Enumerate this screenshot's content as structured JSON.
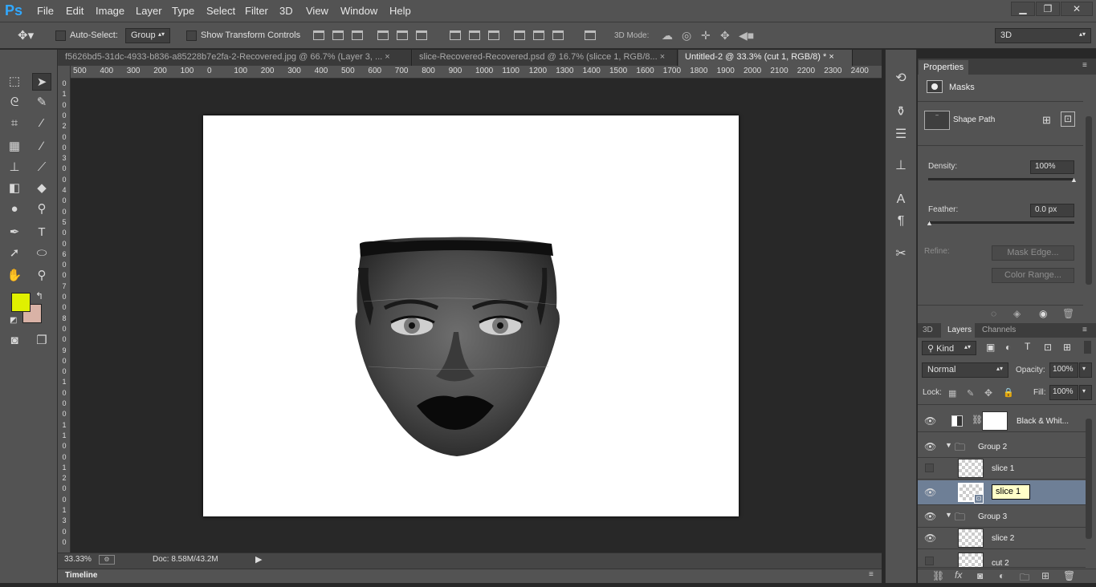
{
  "app": {
    "logo": "Ps"
  },
  "menu": [
    "File",
    "Edit",
    "Image",
    "Layer",
    "Type",
    "Select",
    "Filter",
    "3D",
    "View",
    "Window",
    "Help"
  ],
  "window_controls": {
    "minimize": "▁",
    "restore": "❐",
    "close": "✕"
  },
  "options": {
    "auto_select_label": "Auto-Select:",
    "auto_select_value": "Group",
    "show_transform_label": "Show Transform Controls",
    "mode3d_label": "3D Mode:",
    "workspace_value": "3D"
  },
  "tabs": [
    {
      "label": "f5626bd5-31dc-4933-b836-a85228b7e2fa-2-Recovered.jpg @ 66.7% (Layer 3, ...",
      "close": "×"
    },
    {
      "label": "slice-Recovered-Recovered.psd @ 16.7% (slicce 1, RGB/8...",
      "close": "×"
    },
    {
      "label": "Untitled-2 @ 33.3% (cut 1, RGB/8) *",
      "close": "×"
    }
  ],
  "ruler_h": [
    "500",
    "400",
    "300",
    "200",
    "100",
    "0",
    "100",
    "200",
    "300",
    "400",
    "500",
    "600",
    "700",
    "800",
    "900",
    "1000",
    "1100",
    "1200",
    "1300",
    "1400",
    "1500",
    "1600",
    "1700",
    "1800",
    "1900",
    "2000",
    "2100",
    "2200",
    "2300",
    "2400"
  ],
  "ruler_v": [
    "0",
    "1",
    "0",
    "0",
    "2",
    "0",
    "0",
    "3",
    "0",
    "0",
    "4",
    "0",
    "0",
    "5",
    "0",
    "0",
    "6",
    "0",
    "0",
    "7",
    "0",
    "0",
    "8",
    "0",
    "0",
    "9",
    "0",
    "0",
    "1",
    "0",
    "0",
    "0",
    "1",
    "1",
    "0",
    "0",
    "1",
    "2",
    "0",
    "0",
    "1",
    "3",
    "0",
    "0"
  ],
  "colors": {
    "foreground": "#e0f000",
    "background": "#d9b2a6",
    "accent": "#31a8ff",
    "selected_layer": "#6e7f96"
  },
  "status": {
    "zoom": "33.33%",
    "doc": "Doc: 8.58M/43.2M"
  },
  "timeline": {
    "label": "Timeline"
  },
  "properties": {
    "tab": "Properties",
    "section": "Masks",
    "shape_path": "Shape Path",
    "density_label": "Density:",
    "density_value": "100%",
    "feather_label": "Feather:",
    "feather_value": "0.0 px",
    "refine_label": "Refine:",
    "mask_edge_button": "Mask Edge...",
    "color_range_button": "Color Range...",
    "density_level": 1.0,
    "feather_level": 0.0
  },
  "layers_panel": {
    "tabs": [
      "3D",
      "Layers",
      "Channels"
    ],
    "filter_kind": "Kind",
    "blend_mode": "Normal",
    "opacity_label": "Opacity:",
    "opacity_value": "100%",
    "lock_label": "Lock:",
    "fill_label": "Fill:",
    "fill_value": "100%",
    "layers": [
      {
        "name": "Black & Whit...",
        "type": "adjustment",
        "visible": true
      },
      {
        "name": "Group 2",
        "type": "group",
        "visible": true
      },
      {
        "name": "slice 1",
        "type": "layer",
        "visible": false
      },
      {
        "name": "slice 1",
        "type": "layer-editing",
        "visible": true
      },
      {
        "name": "Group 3",
        "type": "group",
        "visible": true
      },
      {
        "name": "slice 2",
        "type": "layer",
        "visible": true
      },
      {
        "name": "cut 2",
        "type": "layer",
        "visible": false
      }
    ]
  }
}
